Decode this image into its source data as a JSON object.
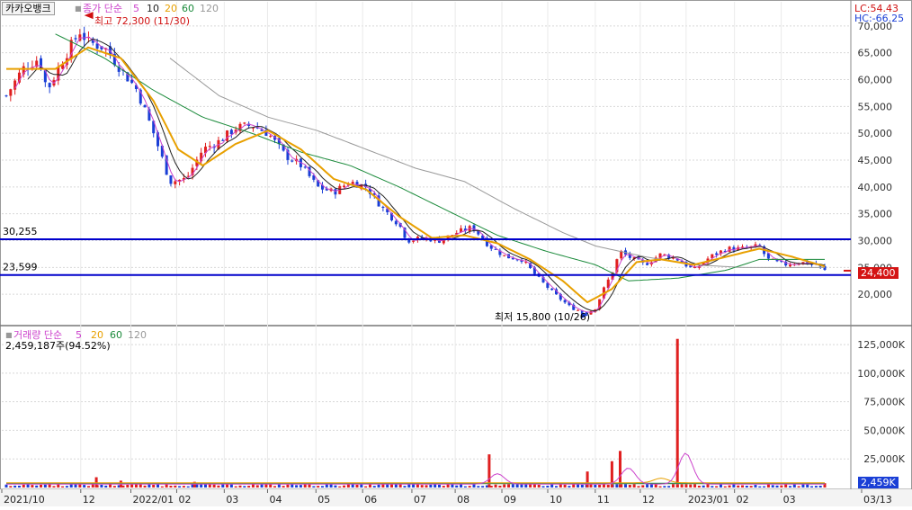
{
  "stock_name": "카카오뱅크",
  "price_legend": {
    "mark": "■",
    "label": "종가 단순",
    "periods": [
      "5",
      "10",
      "20",
      "60",
      "120"
    ]
  },
  "volume_legend": {
    "mark": "■",
    "label": "거래량 단순",
    "periods": [
      "5",
      "20",
      "60",
      "120"
    ]
  },
  "volume_info": "2,459,187주(94.52%)",
  "lc_label": "LC:54.43",
  "hc_label": "HC:-66.25",
  "high_annotation": "최고 72,300 (11/30)",
  "low_annotation": "최저 15,800 (10/26)",
  "current_price_box": "24,400",
  "current_volume_box": "2,459K",
  "colors": {
    "up": "#e02020",
    "down": "#1a3fd6",
    "ma5": "#cc44cc",
    "ma10": "#222222",
    "ma20": "#e8a000",
    "ma60": "#1a8a3a",
    "ma120": "#999999",
    "hline": "#0000cc",
    "grid": "#d8d8d8"
  },
  "chart_data": [
    {
      "type": "candlestick",
      "title": "카카오뱅크",
      "series": [
        {
          "name": "종가 단순 5"
        },
        {
          "name": "10"
        },
        {
          "name": "20"
        },
        {
          "name": "60"
        },
        {
          "name": "120"
        }
      ],
      "y_ticks": [
        20000,
        25000,
        30000,
        35000,
        40000,
        45000,
        50000,
        55000,
        60000,
        65000,
        70000
      ],
      "y_tick_labels": [
        "20,000",
        "25,000",
        "30,000",
        "35,000",
        "40,000",
        "45,000",
        "50,000",
        "55,000",
        "60,000",
        "65,000",
        "70,000"
      ],
      "ylim": [
        14500,
        74500
      ],
      "x_ticks": [
        "2021/10",
        "12",
        "2022/01",
        "02",
        "03",
        "04",
        "05",
        "06",
        "07",
        "08",
        "09",
        "10",
        "11",
        "12",
        "2023/01",
        "02",
        "03",
        "03/13"
      ],
      "horizontal_lines": [
        {
          "label": "30,255",
          "value": 30255
        },
        {
          "label": "23,599",
          "value": 23599
        }
      ],
      "high": {
        "value": 72300,
        "date": "11/30"
      },
      "low": {
        "value": 15800,
        "date": "10/26"
      },
      "last_price": 24400,
      "close_points": [
        {
          "t": 0.0,
          "v": 57000
        },
        {
          "t": 0.02,
          "v": 62000
        },
        {
          "t": 0.04,
          "v": 64000
        },
        {
          "t": 0.05,
          "v": 58000
        },
        {
          "t": 0.07,
          "v": 64000
        },
        {
          "t": 0.09,
          "v": 69000
        },
        {
          "t": 0.1,
          "v": 67000
        },
        {
          "t": 0.12,
          "v": 66000
        },
        {
          "t": 0.14,
          "v": 62000
        },
        {
          "t": 0.16,
          "v": 58000
        },
        {
          "t": 0.18,
          "v": 50000
        },
        {
          "t": 0.2,
          "v": 41000
        },
        {
          "t": 0.22,
          "v": 41500
        },
        {
          "t": 0.24,
          "v": 47000
        },
        {
          "t": 0.26,
          "v": 48500
        },
        {
          "t": 0.28,
          "v": 51000
        },
        {
          "t": 0.3,
          "v": 51500
        },
        {
          "t": 0.32,
          "v": 50000
        },
        {
          "t": 0.34,
          "v": 46000
        },
        {
          "t": 0.36,
          "v": 44000
        },
        {
          "t": 0.38,
          "v": 40000
        },
        {
          "t": 0.4,
          "v": 39000
        },
        {
          "t": 0.42,
          "v": 41000
        },
        {
          "t": 0.44,
          "v": 40000
        },
        {
          "t": 0.46,
          "v": 36000
        },
        {
          "t": 0.48,
          "v": 33000
        },
        {
          "t": 0.49,
          "v": 30000
        },
        {
          "t": 0.51,
          "v": 30500
        },
        {
          "t": 0.53,
          "v": 30000
        },
        {
          "t": 0.55,
          "v": 31500
        },
        {
          "t": 0.57,
          "v": 32500
        },
        {
          "t": 0.59,
          "v": 29000
        },
        {
          "t": 0.61,
          "v": 27000
        },
        {
          "t": 0.63,
          "v": 26500
        },
        {
          "t": 0.65,
          "v": 23000
        },
        {
          "t": 0.67,
          "v": 20000
        },
        {
          "t": 0.69,
          "v": 17500
        },
        {
          "t": 0.71,
          "v": 16500
        },
        {
          "t": 0.72,
          "v": 17500
        },
        {
          "t": 0.73,
          "v": 21000
        },
        {
          "t": 0.74,
          "v": 24000
        },
        {
          "t": 0.75,
          "v": 28000
        },
        {
          "t": 0.76,
          "v": 27000
        },
        {
          "t": 0.78,
          "v": 25500
        },
        {
          "t": 0.8,
          "v": 27500
        },
        {
          "t": 0.82,
          "v": 26500
        },
        {
          "t": 0.84,
          "v": 24500
        },
        {
          "t": 0.86,
          "v": 27000
        },
        {
          "t": 0.88,
          "v": 28500
        },
        {
          "t": 0.9,
          "v": 28500
        },
        {
          "t": 0.92,
          "v": 29000
        },
        {
          "t": 0.93,
          "v": 26500
        },
        {
          "t": 0.95,
          "v": 25500
        },
        {
          "t": 0.97,
          "v": 26000
        },
        {
          "t": 0.99,
          "v": 25500
        },
        {
          "t": 1.0,
          "v": 24400
        }
      ],
      "ma20_points": [
        {
          "t": 0.0,
          "v": 62000
        },
        {
          "t": 0.06,
          "v": 62000
        },
        {
          "t": 0.1,
          "v": 66000
        },
        {
          "t": 0.14,
          "v": 64000
        },
        {
          "t": 0.18,
          "v": 56000
        },
        {
          "t": 0.21,
          "v": 47000
        },
        {
          "t": 0.24,
          "v": 44000
        },
        {
          "t": 0.28,
          "v": 48000
        },
        {
          "t": 0.32,
          "v": 50500
        },
        {
          "t": 0.36,
          "v": 47000
        },
        {
          "t": 0.4,
          "v": 41500
        },
        {
          "t": 0.44,
          "v": 39500
        },
        {
          "t": 0.48,
          "v": 34500
        },
        {
          "t": 0.52,
          "v": 30500
        },
        {
          "t": 0.56,
          "v": 31000
        },
        {
          "t": 0.6,
          "v": 29500
        },
        {
          "t": 0.64,
          "v": 26500
        },
        {
          "t": 0.68,
          "v": 22500
        },
        {
          "t": 0.71,
          "v": 18500
        },
        {
          "t": 0.74,
          "v": 21000
        },
        {
          "t": 0.77,
          "v": 26000
        },
        {
          "t": 0.8,
          "v": 26500
        },
        {
          "t": 0.84,
          "v": 25500
        },
        {
          "t": 0.88,
          "v": 27000
        },
        {
          "t": 0.92,
          "v": 28500
        },
        {
          "t": 0.96,
          "v": 27000
        },
        {
          "t": 1.0,
          "v": 25200
        }
      ],
      "ma60_points": [
        {
          "t": 0.06,
          "v": 68500
        },
        {
          "t": 0.12,
          "v": 64000
        },
        {
          "t": 0.18,
          "v": 58000
        },
        {
          "t": 0.24,
          "v": 53000
        },
        {
          "t": 0.3,
          "v": 50000
        },
        {
          "t": 0.36,
          "v": 46500
        },
        {
          "t": 0.42,
          "v": 44000
        },
        {
          "t": 0.48,
          "v": 40000
        },
        {
          "t": 0.54,
          "v": 35500
        },
        {
          "t": 0.6,
          "v": 31000
        },
        {
          "t": 0.66,
          "v": 28000
        },
        {
          "t": 0.72,
          "v": 25500
        },
        {
          "t": 0.76,
          "v": 22500
        },
        {
          "t": 0.82,
          "v": 23000
        },
        {
          "t": 0.88,
          "v": 24500
        },
        {
          "t": 0.92,
          "v": 26500
        },
        {
          "t": 1.0,
          "v": 26500
        }
      ],
      "ma120_points": [
        {
          "t": 0.2,
          "v": 64000
        },
        {
          "t": 0.26,
          "v": 57000
        },
        {
          "t": 0.32,
          "v": 53000
        },
        {
          "t": 0.38,
          "v": 50500
        },
        {
          "t": 0.44,
          "v": 47000
        },
        {
          "t": 0.5,
          "v": 43500
        },
        {
          "t": 0.56,
          "v": 41000
        },
        {
          "t": 0.62,
          "v": 36000
        },
        {
          "t": 0.68,
          "v": 31500
        },
        {
          "t": 0.72,
          "v": 29000
        },
        {
          "t": 0.78,
          "v": 27000
        },
        {
          "t": 0.84,
          "v": 25500
        },
        {
          "t": 0.9,
          "v": 25000
        },
        {
          "t": 1.0,
          "v": 25000
        }
      ]
    },
    {
      "type": "bar",
      "title": "거래량",
      "series": [
        {
          "name": "거래량 단순 5"
        },
        {
          "name": "20"
        },
        {
          "name": "60"
        },
        {
          "name": "120"
        }
      ],
      "y_ticks": [
        25000,
        50000,
        75000,
        100000,
        125000
      ],
      "y_tick_labels": [
        "25,000K",
        "50,000K",
        "75,000K",
        "100,000K",
        "125,000K"
      ],
      "ylim": [
        0,
        140000
      ],
      "last_volume_k": 2459,
      "spikes": [
        {
          "t": 0.11,
          "v": 9000
        },
        {
          "t": 0.14,
          "v": 6000
        },
        {
          "t": 0.23,
          "v": 5000
        },
        {
          "t": 0.59,
          "v": 29000
        },
        {
          "t": 0.71,
          "v": 14000
        },
        {
          "t": 0.74,
          "v": 23000
        },
        {
          "t": 0.75,
          "v": 32000
        },
        {
          "t": 0.82,
          "v": 130000
        }
      ],
      "ma5_bumps": [
        {
          "t": 0.6,
          "v": 9000
        },
        {
          "t": 0.76,
          "v": 14000
        },
        {
          "t": 0.83,
          "v": 27000
        }
      ]
    }
  ]
}
